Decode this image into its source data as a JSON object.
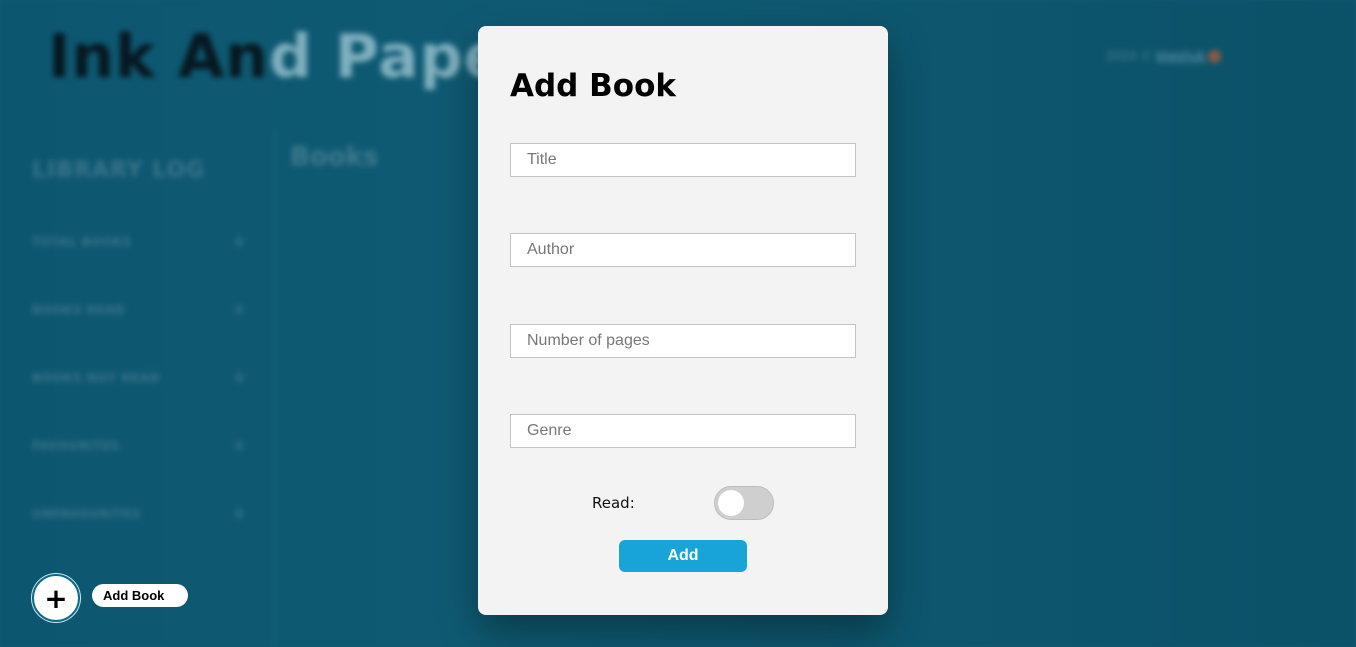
{
  "app": {
    "title_dark": "Ink An",
    "title_light": "d Paper",
    "credit": "2024 ©",
    "credit_link": "kkeshuk"
  },
  "sidebar": {
    "heading": "LIBRARY LOG",
    "stats": [
      {
        "label": "TOTAL BOOKS",
        "value": "0"
      },
      {
        "label": "BOOKS READ",
        "value": "0"
      },
      {
        "label": "BOOKS NOT READ",
        "value": "0"
      },
      {
        "label": "FAVOURITES",
        "value": "0"
      },
      {
        "label": "UNFAVOURITES",
        "value": "0"
      }
    ]
  },
  "main": {
    "heading": "Books"
  },
  "fab": {
    "icon": "plus-icon",
    "symbol": "+",
    "label": "Add Book"
  },
  "dialog": {
    "title": "Add Book",
    "fields": {
      "title_placeholder": "Title",
      "author_placeholder": "Author",
      "pages_placeholder": "Number of pages",
      "genre_placeholder": "Genre"
    },
    "read_label": "Read:",
    "read_value": false,
    "submit_label": "Add"
  },
  "colors": {
    "background": "#0f5a72",
    "dialog": "#f3f3f3",
    "button": "#18a4d6"
  }
}
